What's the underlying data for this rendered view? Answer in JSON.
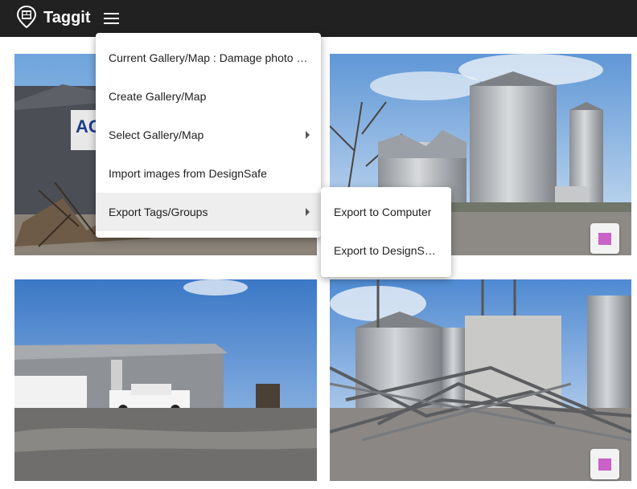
{
  "app": {
    "title": "Taggit"
  },
  "menu": {
    "items": [
      {
        "label": "Current Gallery/Map : Damage photo album",
        "has_submenu": false
      },
      {
        "label": "Create Gallery/Map",
        "has_submenu": false
      },
      {
        "label": "Select Gallery/Map",
        "has_submenu": true
      },
      {
        "label": "Import images from DesignSafe",
        "has_submenu": false
      },
      {
        "label": "Export Tags/Groups",
        "has_submenu": true,
        "active": true
      }
    ]
  },
  "submenu": {
    "items": [
      {
        "label": "Export to Computer"
      },
      {
        "label": "Export to DesignSafe"
      }
    ]
  },
  "gallery": {
    "images": [
      {
        "subject": "damaged warehouse with sign"
      },
      {
        "subject": "grain silos with damaged bin"
      },
      {
        "subject": "collapsed metal shed and white pickup truck"
      },
      {
        "subject": "collapsed grain elevator structure"
      }
    ]
  },
  "colors": {
    "topbar": "#212121",
    "select_marker": "#c961c9"
  }
}
